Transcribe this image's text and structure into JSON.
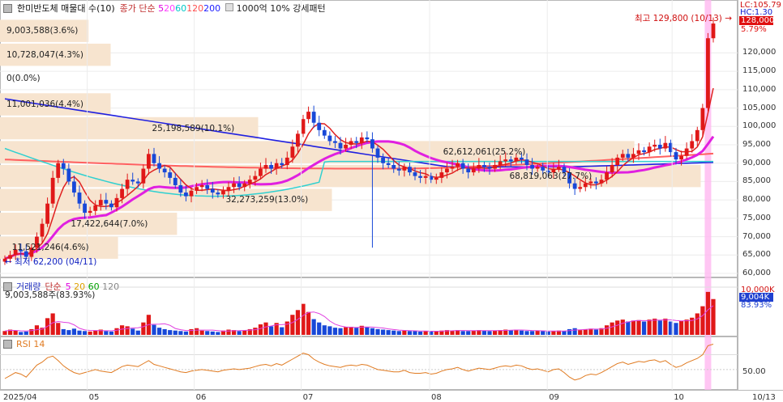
{
  "legend": {
    "title": "한미반도체 매물대 수(10)",
    "ma_label": "종가 단순",
    "ma_periods": [
      {
        "p": "5",
        "color": "#e000e0"
      },
      {
        "p": "20",
        "color": "#ff40ff"
      },
      {
        "p": "60",
        "color": "#00c8c8"
      },
      {
        "p": "120",
        "color": "#ff5050"
      },
      {
        "p": "200",
        "color": "#2020ff"
      }
    ],
    "extra": "1000억 10% 강세패턴"
  },
  "price_axis": {
    "lc": "LC:105.79",
    "hc": "HC:1.30",
    "current": "128,000",
    "current_pct": "5.79%",
    "ticks": [
      "120,000",
      "115,000",
      "110,000",
      "105,000",
      "100,000",
      "95,000",
      "90,000",
      "85,000",
      "80,000",
      "75,000",
      "70,000",
      "65,000",
      "60,000"
    ]
  },
  "annotations": {
    "high": "최고 129,800 (10/13)",
    "low": "최저 62,200 (04/11)"
  },
  "volume_profile": [
    {
      "label": "9,003,588(3.6%)",
      "price": 126000,
      "wfrac": 0.12
    },
    {
      "label": "10,728,047(4.3%)",
      "price": 119500,
      "wfrac": 0.15
    },
    {
      "label": "0(0.0%)",
      "price": 113000,
      "wfrac": 0.0
    },
    {
      "label": "11,001,036(4.4%)",
      "price": 106000,
      "wfrac": 0.15
    },
    {
      "label": "25,198,589(10.1%)",
      "price": 99500,
      "wfrac": 0.35
    },
    {
      "label": "62,612,061(25.2%)",
      "price": 93000,
      "wfrac": 0.86
    },
    {
      "label": "68,819,063(27.7%)",
      "price": 86500,
      "wfrac": 0.95
    },
    {
      "label": "32,273,259(13.0%)",
      "price": 80000,
      "wfrac": 0.45
    },
    {
      "label": "17,422,644(7.0%)",
      "price": 73500,
      "wfrac": 0.24
    },
    {
      "label": "11,521,246(4.6%)",
      "price": 67000,
      "wfrac": 0.16
    }
  ],
  "volume_panel": {
    "label": "거래량",
    "ma_label": "단순",
    "ma_periods": [
      {
        "p": "5",
        "color": "#e000e0"
      },
      {
        "p": "20",
        "color": "#e0a000"
      },
      {
        "p": "60",
        "color": "#00a000"
      },
      {
        "p": "120",
        "color": "#888888"
      }
    ],
    "value_text": "9,003,588주(83.93%)",
    "axis_max": "10,000K",
    "badge": "9,004K",
    "badge_pct": "83.93%"
  },
  "rsi_panel": {
    "label": "RSI 14",
    "axis_label": "50.00"
  },
  "x_axis": [
    "2025/04",
    "05",
    "06",
    "07",
    "08",
    "09",
    "10",
    "10/13"
  ],
  "chart_data": {
    "type": "candlestick",
    "title": "한미반도체",
    "ylim": [
      60000,
      130000
    ],
    "support_price": 89000,
    "daily_close": [
      64000,
      65000,
      66500,
      66000,
      64500,
      67000,
      70000,
      73500,
      79000,
      86000,
      90000,
      88500,
      85000,
      82000,
      79000,
      76500,
      77000,
      78500,
      80000,
      79000,
      78000,
      80500,
      83000,
      85500,
      85000,
      84500,
      88500,
      92500,
      90000,
      88500,
      87500,
      86000,
      84000,
      82000,
      81000,
      82500,
      83500,
      84000,
      83000,
      82000,
      81500,
      82500,
      83500,
      84500,
      83500,
      84500,
      85500,
      86500,
      88500,
      89500,
      88500,
      90000,
      89500,
      91500,
      94500,
      98000,
      102000,
      104000,
      101000,
      99000,
      97500,
      96000,
      95500,
      94000,
      95000,
      96000,
      95500,
      97000,
      96500,
      94000,
      91500,
      90000,
      89500,
      88500,
      88000,
      89000,
      87500,
      86500,
      86000,
      86500,
      85500,
      86000,
      87500,
      88500,
      89000,
      90000,
      88500,
      87500,
      88500,
      89500,
      89000,
      88500,
      89500,
      90500,
      91000,
      90500,
      91500,
      91000,
      89500,
      88500,
      89000,
      88000,
      87500,
      88500,
      89000,
      87500,
      84500,
      83000,
      83500,
      84500,
      85000,
      84500,
      85500,
      87500,
      89500,
      91500,
      92500,
      91500,
      92500,
      93500,
      93000,
      94500,
      95000,
      94000,
      95500,
      93000,
      91000,
      92000,
      94000,
      96000,
      99000,
      105000,
      124000,
      128000
    ],
    "volume_k": [
      800,
      1100,
      900,
      600,
      700,
      1200,
      2000,
      1500,
      3500,
      4500,
      2500,
      1200,
      1000,
      1300,
      900,
      800,
      700,
      900,
      1100,
      800,
      700,
      1400,
      2000,
      1800,
      1300,
      900,
      2600,
      4200,
      2100,
      1500,
      1200,
      1000,
      900,
      800,
      700,
      1200,
      1400,
      900,
      800,
      700,
      600,
      900,
      1100,
      1000,
      800,
      900,
      1200,
      1500,
      2200,
      2600,
      1800,
      2500,
      1600,
      2800,
      4200,
      5200,
      6500,
      4800,
      3300,
      2600,
      2000,
      1800,
      1500,
      1400,
      1600,
      1700,
      1500,
      1900,
      1600,
      1400,
      1200,
      1100,
      1000,
      900,
      800,
      900,
      800,
      800,
      700,
      800,
      700,
      800,
      900,
      1000,
      900,
      1000,
      800,
      800,
      900,
      1000,
      900,
      800,
      900,
      1000,
      1100,
      1000,
      1100,
      900,
      800,
      800,
      900,
      800,
      700,
      800,
      900,
      800,
      1200,
      1400,
      1000,
      1200,
      1300,
      1100,
      1400,
      2000,
      2600,
      3000,
      3200,
      2800,
      3000,
      3100,
      2800,
      3200,
      3400,
      3000,
      3400,
      2800,
      2500,
      2900,
      3200,
      3600,
      4500,
      6000,
      9004,
      7500
    ],
    "rsi": [
      38,
      42,
      46,
      44,
      40,
      48,
      56,
      60,
      66,
      68,
      62,
      55,
      50,
      46,
      44,
      46,
      48,
      50,
      48,
      47,
      46,
      50,
      54,
      56,
      55,
      54,
      58,
      62,
      57,
      55,
      53,
      51,
      49,
      47,
      46,
      48,
      49,
      50,
      49,
      48,
      47,
      49,
      50,
      51,
      50,
      51,
      52,
      54,
      56,
      57,
      55,
      58,
      56,
      60,
      64,
      68,
      72,
      70,
      64,
      60,
      57,
      55,
      54,
      53,
      55,
      56,
      55,
      57,
      56,
      53,
      50,
      49,
      48,
      47,
      47,
      49,
      46,
      45,
      45,
      46,
      44,
      45,
      48,
      50,
      51,
      53,
      50,
      48,
      50,
      52,
      51,
      50,
      52,
      54,
      55,
      54,
      56,
      55,
      52,
      50,
      51,
      49,
      47,
      50,
      51,
      46,
      40,
      36,
      38,
      42,
      44,
      43,
      46,
      50,
      54,
      58,
      60,
      57,
      59,
      61,
      60,
      62,
      63,
      60,
      62,
      57,
      53,
      55,
      59,
      62,
      65,
      70,
      82,
      84
    ]
  }
}
